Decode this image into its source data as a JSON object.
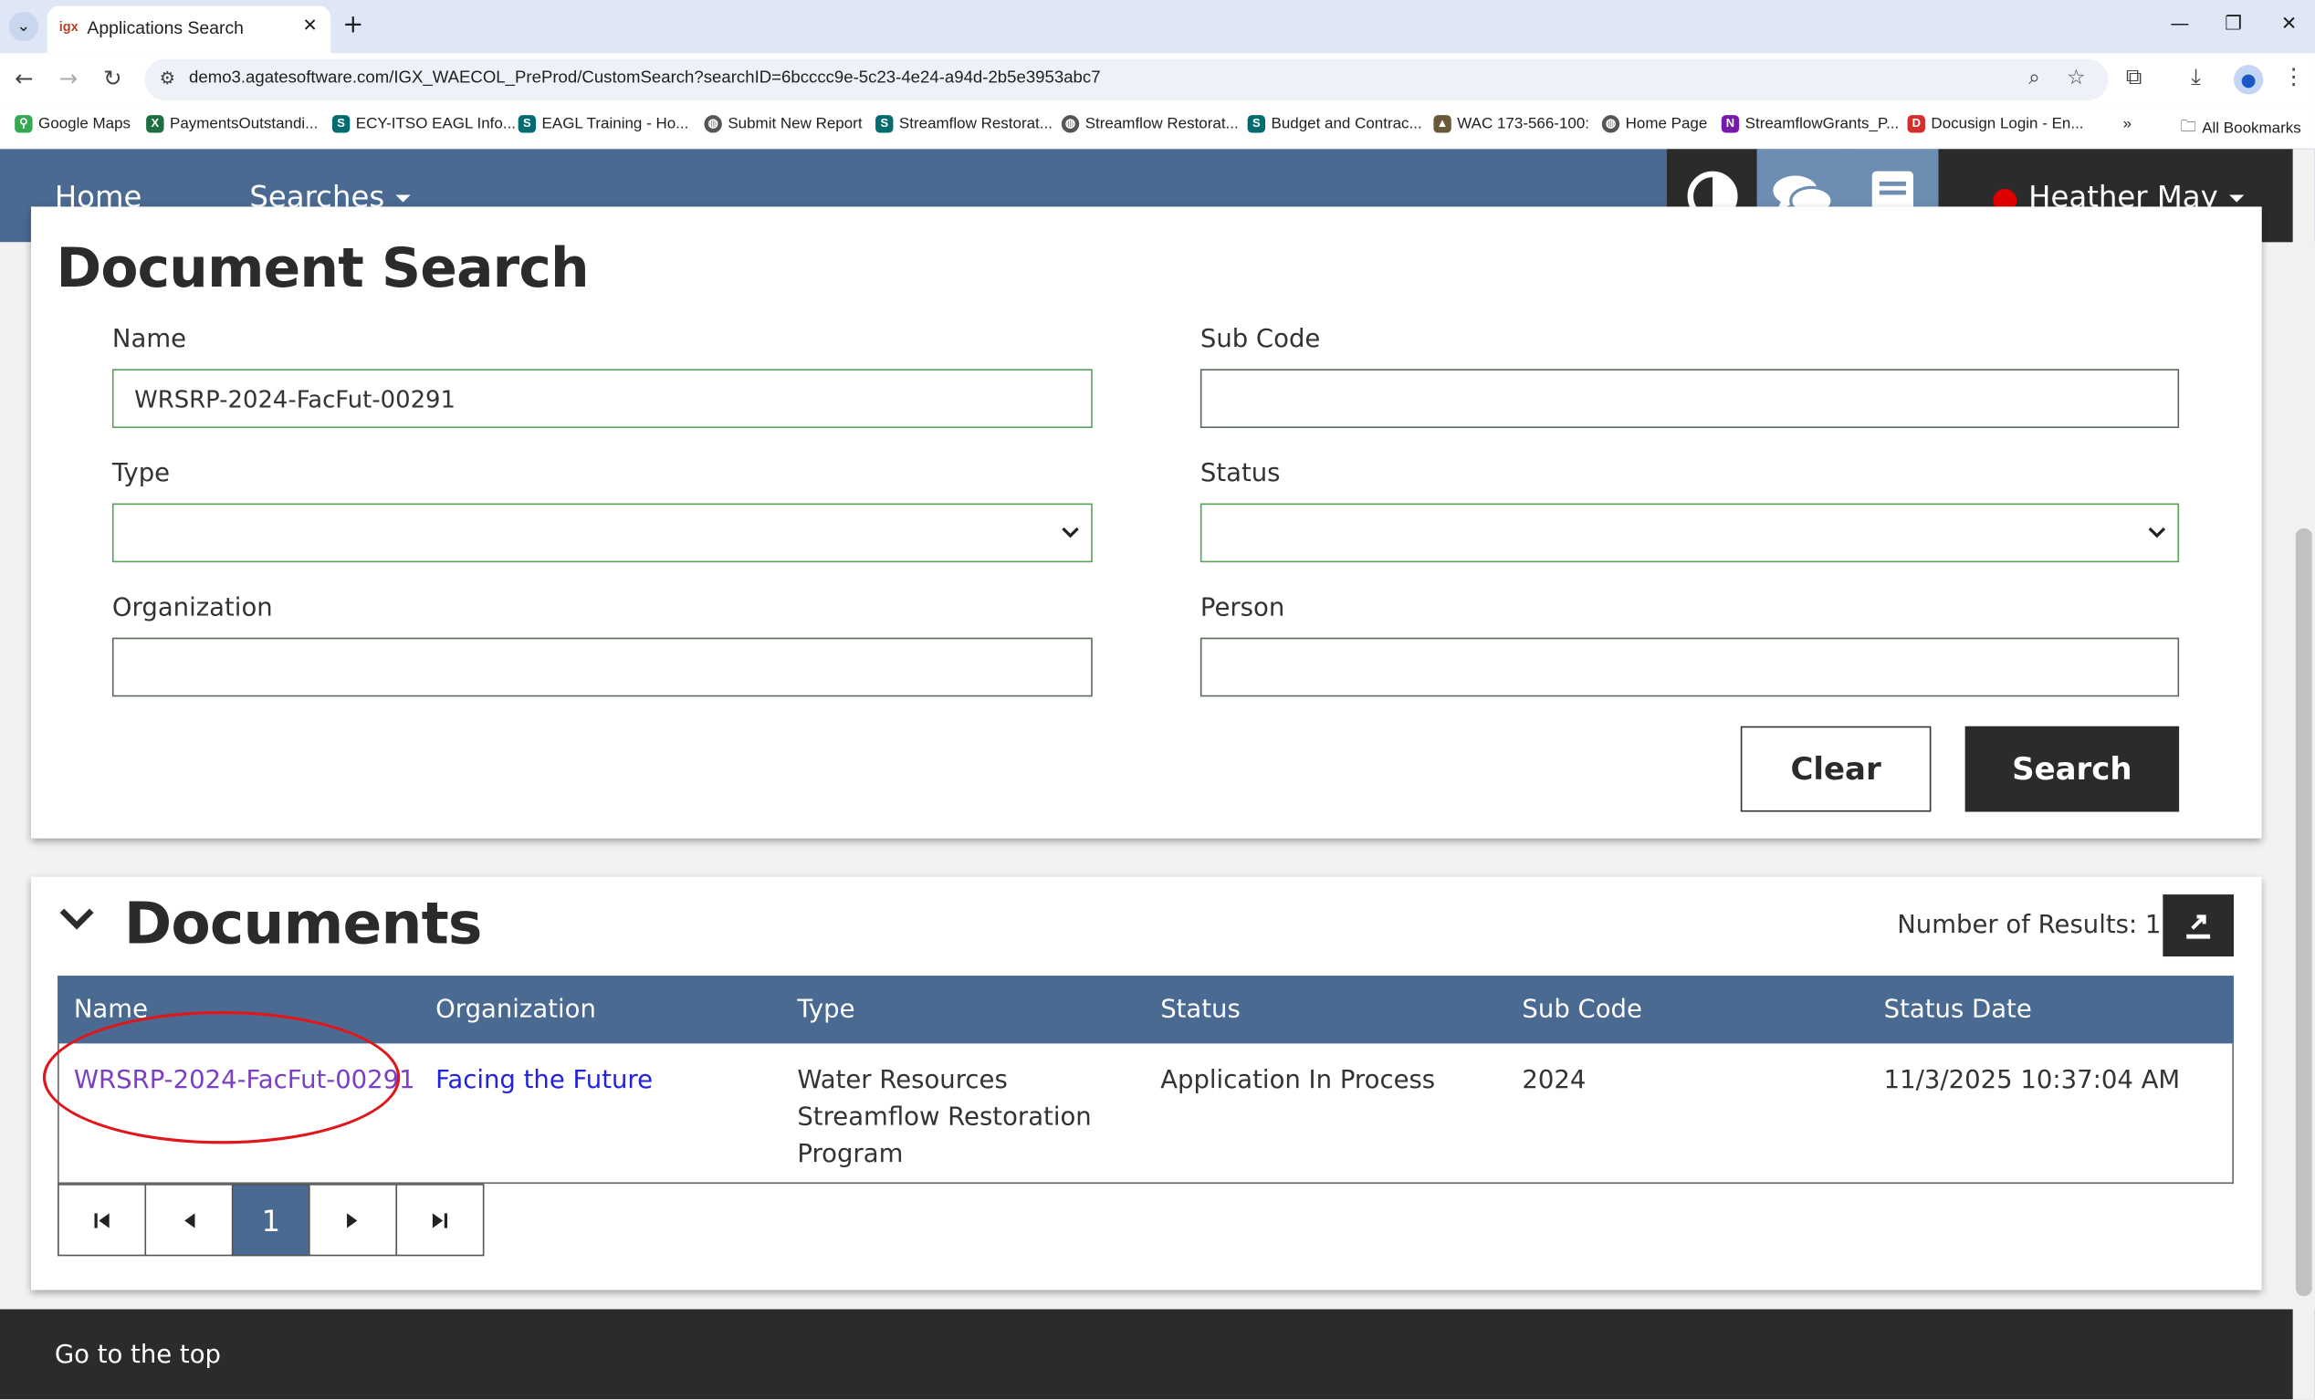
{
  "browser": {
    "tab_title": "Applications Search",
    "tab_favicon": "igx",
    "url": "demo3.agatesoftware.com/IGX_WAECOL_PreProd/CustomSearch?searchID=6bcccc9e-5c23-4e24-a94d-2b5e3953abc7",
    "bookmarks": [
      {
        "label": "Google Maps",
        "icon": "map-pin-icon",
        "color": "#34a853"
      },
      {
        "label": "PaymentsOutstandi...",
        "icon": "excel-icon",
        "color": "#1d6f42"
      },
      {
        "label": "ECY-ITSO EAGL Info...",
        "icon": "sharepoint-icon",
        "color": "#036c70"
      },
      {
        "label": "EAGL Training - Ho...",
        "icon": "sharepoint-icon",
        "color": "#036c70"
      },
      {
        "label": "Submit New Report",
        "icon": "globe-icon",
        "color": "#555555"
      },
      {
        "label": "Streamflow Restorat...",
        "icon": "sharepoint-icon",
        "color": "#036c70"
      },
      {
        "label": "Streamflow Restorat...",
        "icon": "globe-icon",
        "color": "#555555"
      },
      {
        "label": "Budget and Contrac...",
        "icon": "sharepoint-icon",
        "color": "#036c70"
      },
      {
        "label": "WAC 173-566-100:",
        "icon": "capitol-icon",
        "color": "#6b5a3a"
      },
      {
        "label": "Home Page",
        "icon": "globe-icon",
        "color": "#555555"
      },
      {
        "label": "StreamflowGrants_P...",
        "icon": "onenote-icon",
        "color": "#7719aa"
      },
      {
        "label": "Docusign Login - En...",
        "icon": "docusign-icon",
        "color": "#d42e2e"
      }
    ],
    "all_bookmarks": "All Bookmarks"
  },
  "nav": {
    "home": "Home",
    "searches": "Searches",
    "user": "Heather May"
  },
  "search": {
    "title": "Document Search",
    "name_label": "Name",
    "name_value": "WRSRP-2024-FacFut-00291",
    "subcode_label": "Sub Code",
    "subcode_value": "",
    "type_label": "Type",
    "type_value": "",
    "status_label": "Status",
    "status_value": "",
    "org_label": "Organization",
    "org_value": "",
    "person_label": "Person",
    "person_value": "",
    "clear": "Clear",
    "search": "Search"
  },
  "results": {
    "title": "Documents",
    "count_text": "Number of Results: 1",
    "columns": [
      "Name",
      "Organization",
      "Type",
      "Status",
      "Sub Code",
      "Status Date"
    ],
    "rows": [
      {
        "name": "WRSRP-2024-FacFut-00291",
        "organization": "Facing the Future",
        "type": "Water Resources Streamflow Restoration Program",
        "status": "Application In Process",
        "sub_code": "2024",
        "status_date": "11/3/2025 10:37:04 AM"
      }
    ],
    "current_page": "1"
  },
  "footer": {
    "top_link": "Go to the top"
  },
  "colors": {
    "nav_blue": "#4a6a92",
    "dark": "#2b2b2b",
    "annotation_red": "#e0161b",
    "link_blue": "#2222dd",
    "visited_purple": "#7b3fc4"
  }
}
